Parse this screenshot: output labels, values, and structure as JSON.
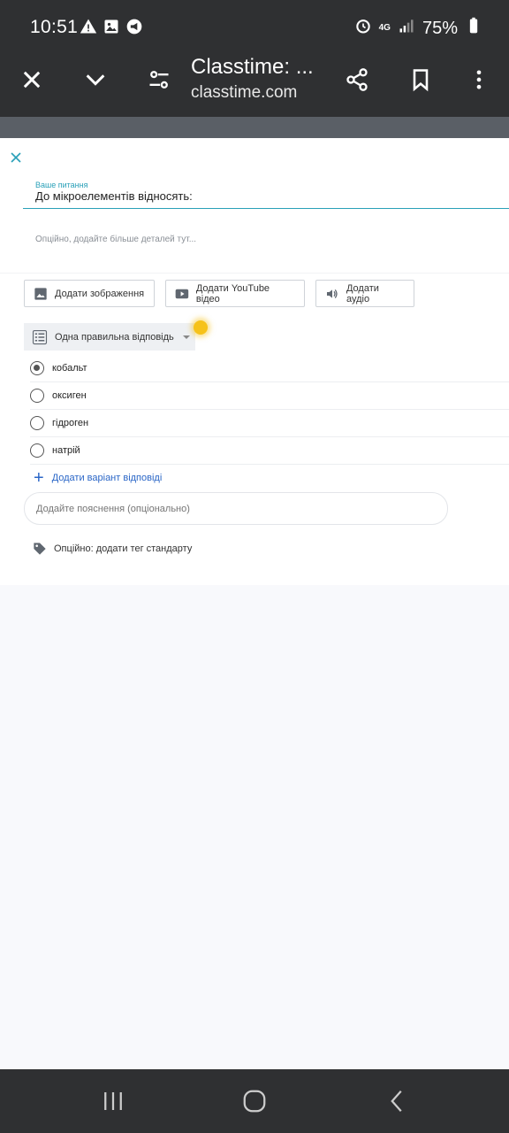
{
  "status_bar": {
    "time": "10:51",
    "network": "4G",
    "battery": "75%",
    "icons": [
      "warning-icon",
      "image-icon",
      "megaphone-icon",
      "alarm-icon",
      "signal-icon",
      "battery-icon"
    ]
  },
  "browser": {
    "title": "Classtime: ...",
    "domain": "classtime.com"
  },
  "question": {
    "label": "Ваше питання",
    "text": "До мікроелементів відносять:",
    "details_placeholder": "Опційно, додайте більше деталей тут..."
  },
  "media": {
    "image_label": "Додати зображення",
    "youtube_label": "Додати YouTube відео",
    "audio_label": "Додати аудіо"
  },
  "question_type": {
    "selected": "Одна правильна відповідь"
  },
  "answers": [
    {
      "text": "кобальт",
      "selected": true
    },
    {
      "text": "оксиген",
      "selected": false
    },
    {
      "text": "гідроген",
      "selected": false
    },
    {
      "text": "натрій",
      "selected": false
    }
  ],
  "add_answer_label": "Додати варіант відповіді",
  "explanation_placeholder": "Додайте пояснення (опціонально)",
  "tag_label": "Опційно: додати тег стандарту",
  "colors": {
    "accent": "#2aa0b8",
    "link": "#2a66c7",
    "toolbar": "#2f3032",
    "highlight": "#f6c21a"
  }
}
